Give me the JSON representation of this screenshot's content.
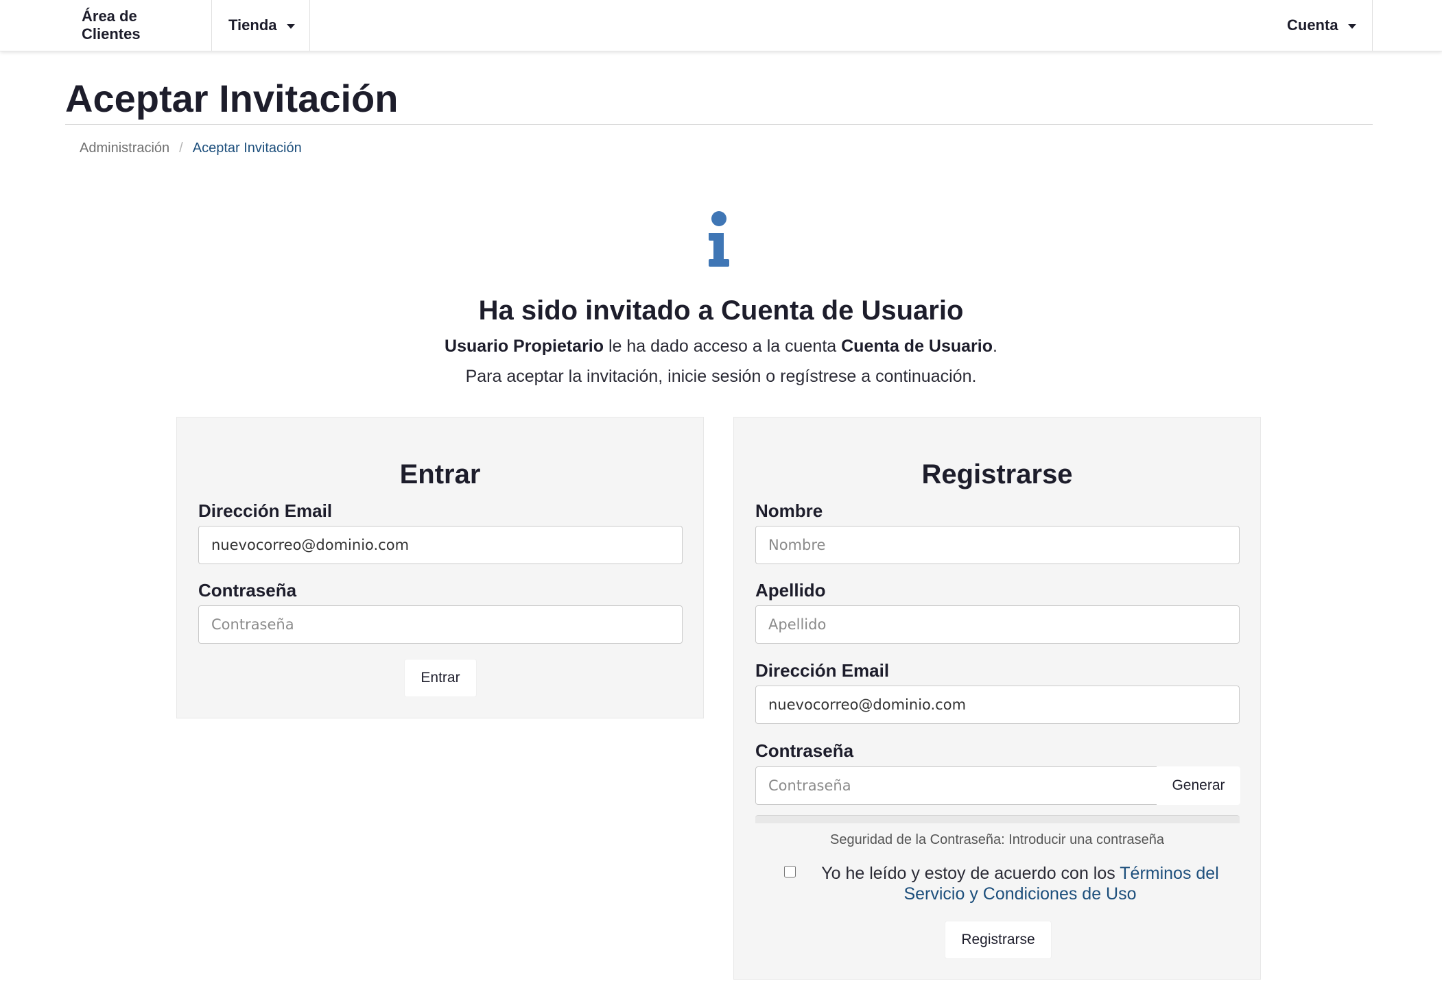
{
  "nav": {
    "clients_label": "Área de Clientes",
    "store_label": "Tienda",
    "account_label": "Cuenta"
  },
  "page": {
    "title": "Aceptar Invitación",
    "breadcrumb": {
      "parent": "Administración",
      "separator": "/",
      "current": "Aceptar Invitación"
    }
  },
  "invite": {
    "icon": "info-icon",
    "heading": "Ha sido invitado a Cuenta de Usuario",
    "owner_name": "Usuario Propietario",
    "access_text": " le ha dado acceso a la cuenta ",
    "account_name": "Cuenta de Usuario",
    "period": ".",
    "instructions": "Para aceptar la invitación, inicie sesión o regístrese a continuación."
  },
  "login": {
    "title": "Entrar",
    "email_label": "Dirección Email",
    "email_value": "nuevocorreo@dominio.com",
    "password_label": "Contraseña",
    "password_placeholder": "Contraseña",
    "submit_label": "Entrar"
  },
  "register": {
    "title": "Registrarse",
    "first_name_label": "Nombre",
    "first_name_placeholder": "Nombre",
    "last_name_label": "Apellido",
    "last_name_placeholder": "Apellido",
    "email_label": "Dirección Email",
    "email_value": "nuevocorreo@dominio.com",
    "password_label": "Contraseña",
    "password_placeholder": "Contraseña",
    "generate_label": "Generar",
    "strength_text": "Seguridad de la Contraseña: Introducir una contraseña",
    "tos_prefix": "Yo he leído y estoy de acuerdo con los ",
    "tos_link": "Términos del Servicio y Condiciones de Uso",
    "submit_label": "Registrarse"
  },
  "colors": {
    "accent_blue": "#3f76b5",
    "link_blue": "#1d4f7c",
    "panel_bg": "#f5f5f5"
  }
}
